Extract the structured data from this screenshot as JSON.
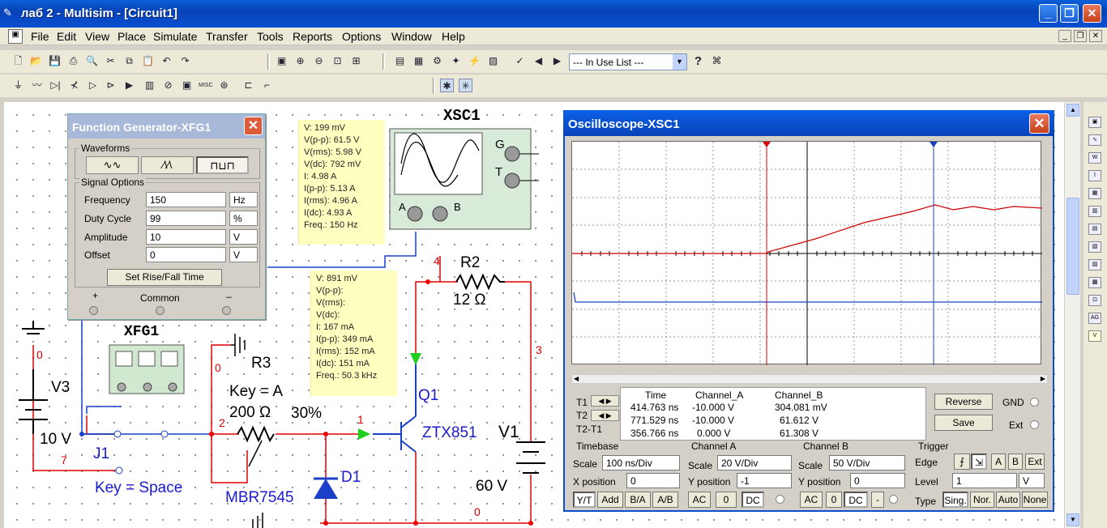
{
  "window": {
    "title": "лаб 2 - Multisim - [Circuit1]"
  },
  "menu": [
    "File",
    "Edit",
    "View",
    "Place",
    "Simulate",
    "Transfer",
    "Tools",
    "Reports",
    "Options",
    "Window",
    "Help"
  ],
  "toolbar": {
    "in_use_list": "--- In Use List ---"
  },
  "function_generator": {
    "title": "Function Generator-XFG1",
    "waveforms_label": "Waveforms",
    "signal_options_label": "Signal Options",
    "params": [
      {
        "label": "Frequency",
        "value": "150",
        "unit": "Hz"
      },
      {
        "label": "Duty Cycle",
        "value": "99",
        "unit": "%"
      },
      {
        "label": "Amplitude",
        "value": "10",
        "unit": "V"
      },
      {
        "label": "Offset",
        "value": "0",
        "unit": "V"
      }
    ],
    "set_rise_fall": "Set Rise/Fall Time",
    "plus": "+",
    "common": "Common",
    "minus": "_"
  },
  "probe1": [
    "V: 199 mV",
    "V(p-p): 61.5 V",
    "V(rms): 5.98 V",
    "V(dc): 792 mV",
    "I: 4.98 A",
    "I(p-p): 5.13 A",
    "I(rms): 4.96 A",
    "I(dc): 4.93 A",
    "Freq.: 150 Hz"
  ],
  "probe2": [
    "V: 891 mV",
    "V(p-p):",
    "V(rms):",
    "V(dc):",
    "I: 167 mA",
    "I(p-p): 349 mA",
    "I(rms): 152 mA",
    "I(dc): 151 mA",
    "Freq.: 50.3 kHz"
  ],
  "circuit": {
    "xsc1": "XSC1",
    "xfg1": "XFG1",
    "r2": "R2",
    "r2_value": "12 Ω",
    "r3": "R3",
    "key_a": "Key = A",
    "pot_value": "200 Ω",
    "pot_percent": "30%",
    "q1": "Q1",
    "q1_model": "ZTX851",
    "v1": "V1",
    "v1_value": "60 V",
    "v3": "V3",
    "v3_value": "10 V",
    "j1": "J1",
    "key_space": "Key = Space",
    "d1": "D1",
    "d1_model": "MBR7545",
    "osc_g": "G",
    "osc_t": "T",
    "osc_a": "A",
    "osc_b": "B",
    "nodes": {
      "n0a": "0",
      "n0b": "0",
      "n0c": "0",
      "n1": "1",
      "n2": "2",
      "n3": "3",
      "n4": "4",
      "n7": "7"
    }
  },
  "oscilloscope": {
    "title": "Oscilloscope-XSC1",
    "readout_headers": [
      "Time",
      "Channel_A",
      "Channel_B"
    ],
    "rows": [
      {
        "label": "T1",
        "time": "414.763 ns",
        "a": "-10.000 V",
        "b": "304.081 mV"
      },
      {
        "label": "T2",
        "time": "771.529 ns",
        "a": "-10.000 V",
        "b": "61.612 V"
      },
      {
        "label": "T2-T1",
        "time": "356.766 ns",
        "a": "0.000 V",
        "b": "61.308 V"
      }
    ],
    "reverse": "Reverse",
    "save": "Save",
    "gnd": "GND",
    "ext": "Ext",
    "timebase": {
      "label": "Timebase",
      "scale_label": "Scale",
      "scale": "100 ns/Div",
      "xpos_label": "X position",
      "xpos": "0",
      "modes": [
        "Y/T",
        "Add",
        "B/A",
        "A/B"
      ]
    },
    "channel_a": {
      "label": "Channel A",
      "scale_label": "Scale",
      "scale": "20  V/Div",
      "ypos_label": "Y position",
      "ypos": "-1",
      "modes": [
        "AC",
        "0",
        "DC"
      ]
    },
    "channel_b": {
      "label": "Channel B",
      "scale_label": "Scale",
      "scale": "50  V/Div",
      "ypos_label": "Y position",
      "ypos": "0",
      "modes": [
        "AC",
        "0",
        "DC",
        "-"
      ]
    },
    "trigger": {
      "label": "Trigger",
      "edge_label": "Edge",
      "level_label": "Level",
      "level": "1",
      "level_unit": "V",
      "type_label": "Type",
      "sources": [
        "A",
        "B",
        "Ext"
      ],
      "types": [
        "Sing.",
        "Nor.",
        "Auto",
        "None"
      ]
    }
  }
}
